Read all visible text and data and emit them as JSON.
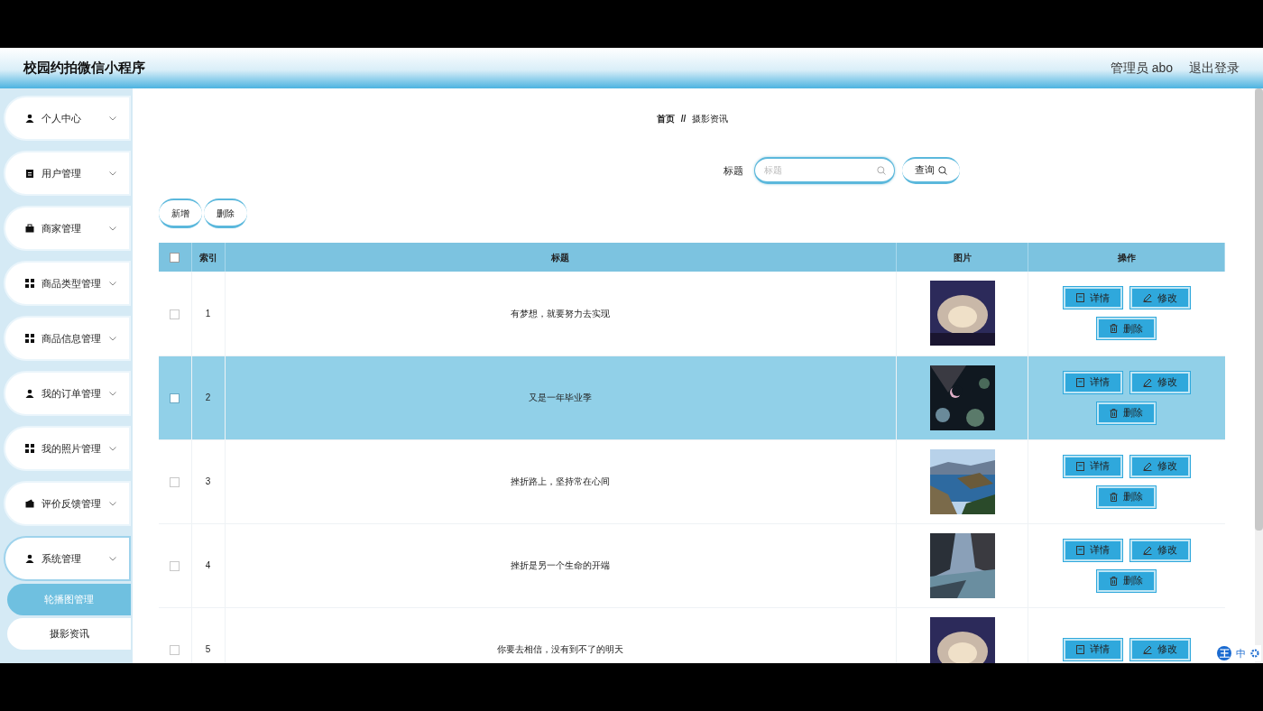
{
  "header": {
    "title": "校园约拍微信小程序",
    "user": "管理员 abo",
    "logout": "退出登录"
  },
  "sidebar": {
    "items": [
      {
        "label": "个人中心",
        "expanded": false
      },
      {
        "label": "用户管理",
        "expanded": false
      },
      {
        "label": "商家管理",
        "expanded": false
      },
      {
        "label": "商品类型管理",
        "expanded": false
      },
      {
        "label": "商品信息管理",
        "expanded": false
      },
      {
        "label": "我的订单管理",
        "expanded": false
      },
      {
        "label": "我的照片管理",
        "expanded": false
      },
      {
        "label": "评价反馈管理",
        "expanded": false
      },
      {
        "label": "系统管理",
        "expanded": true,
        "children": [
          {
            "label": "轮播图管理",
            "selected": true
          },
          {
            "label": "摄影资讯",
            "selected": false
          }
        ]
      }
    ]
  },
  "breadcrumb": [
    "首页",
    "//",
    "摄影资讯"
  ],
  "search": {
    "label": "标题",
    "placeholder": "标题",
    "button": "查询"
  },
  "toolbar": [
    "新增",
    "删除"
  ],
  "table": {
    "all_checked": false,
    "columns": [
      "索引",
      "标题",
      "图片",
      "操作"
    ],
    "rows": [
      {
        "index": "1",
        "title": "有梦想，就要努力去实现",
        "selected": false,
        "checked": false,
        "actions": [
          "详情",
          "修改",
          "删除"
        ]
      },
      {
        "index": "2",
        "title": "又是一年毕业季",
        "selected": true,
        "checked": false,
        "actions": [
          "详情",
          "修改",
          "删除"
        ]
      },
      {
        "index": "3",
        "title": "挫折路上，坚持常在心间",
        "selected": false,
        "checked": false,
        "actions": [
          "详情",
          "修改",
          "删除"
        ]
      },
      {
        "index": "4",
        "title": "挫折是另一个生命的开端",
        "selected": false,
        "checked": false,
        "actions": [
          "详情",
          "修改",
          "删除"
        ]
      },
      {
        "index": "5",
        "title": "你要去相信，没有到不了的明天",
        "selected": false,
        "checked": false,
        "actions": [
          "详情",
          "修改"
        ]
      }
    ]
  },
  "ime": [
    "王",
    "中"
  ]
}
